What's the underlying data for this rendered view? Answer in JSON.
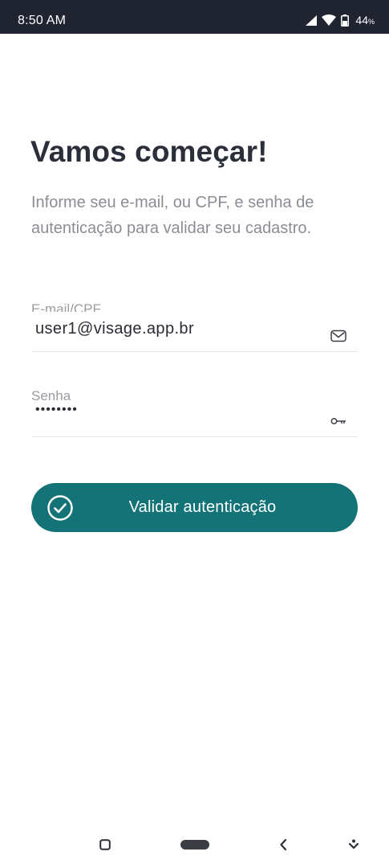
{
  "status_bar": {
    "time": "8:50 AM",
    "battery_percent": "44",
    "battery_unit": "%",
    "icons": [
      "signal-icon",
      "wifi-icon",
      "battery-icon"
    ]
  },
  "screen": {
    "title": "Vamos começar!",
    "subtitle": "Informe seu e-mail, ou CPF, e senha de autenticação para validar seu cadastro."
  },
  "form": {
    "email": {
      "label": "E-mail/CPF",
      "value": "user1@visage.app.br",
      "icon": "mail-icon"
    },
    "password": {
      "label": "Senha",
      "value": "••••••••",
      "icon": "key-icon"
    },
    "submit": {
      "label": "Validar autenticação",
      "icon": "check-circle-icon"
    }
  },
  "nav_bar": {
    "icons": [
      "recents-icon",
      "home-pill-icon",
      "back-icon",
      "hide-nav-icon"
    ]
  },
  "colors": {
    "status_bar_bg": "#1f2430",
    "accent": "#147376",
    "title": "#2b2f3a",
    "subtitle": "#8a8d94"
  }
}
